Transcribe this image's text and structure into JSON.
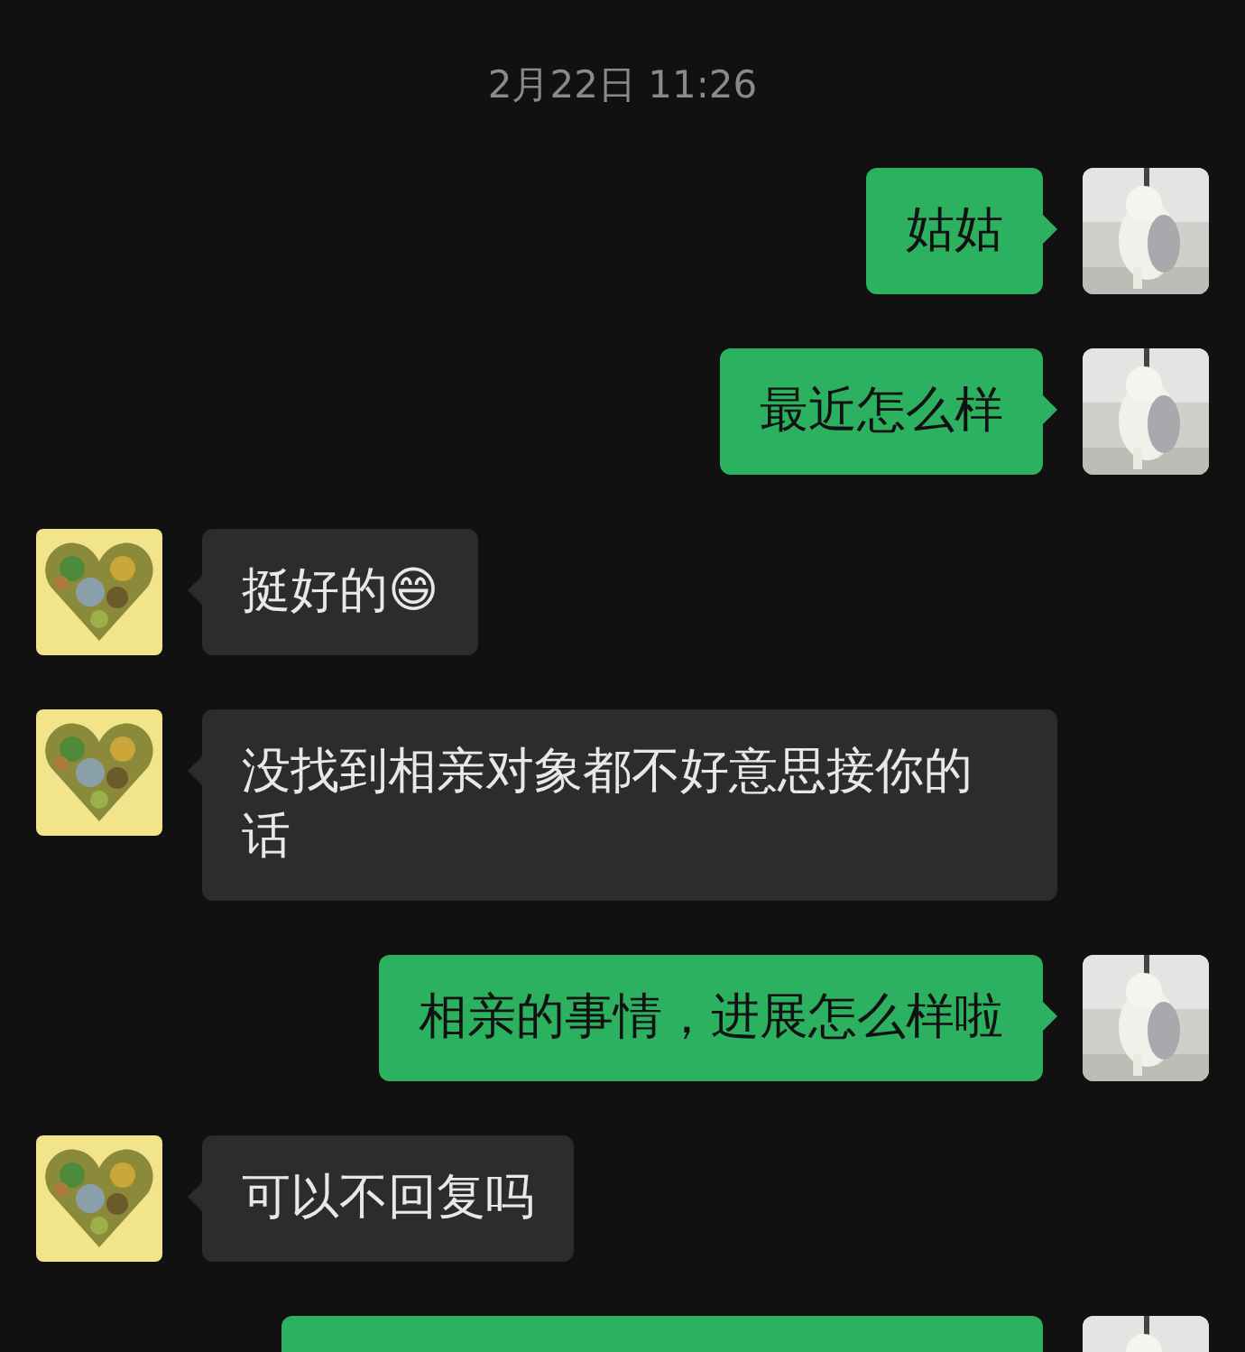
{
  "timestamp": "2月22日 11:26",
  "messages": [
    {
      "kind": "sent",
      "text": "姑姑",
      "cut": false
    },
    {
      "kind": "sent",
      "text": "最近怎么样",
      "cut": false
    },
    {
      "kind": "received",
      "text": "挺好的😄",
      "cut": false
    },
    {
      "kind": "received",
      "text": "没找到相亲对象都不好意思接你的话",
      "cut": false
    },
    {
      "kind": "sent",
      "text": "相亲的事情，进展怎么样啦",
      "cut": false
    },
    {
      "kind": "received",
      "text": "可以不回复吗",
      "cut": false
    },
    {
      "kind": "sent",
      "cut": true
    }
  ]
}
